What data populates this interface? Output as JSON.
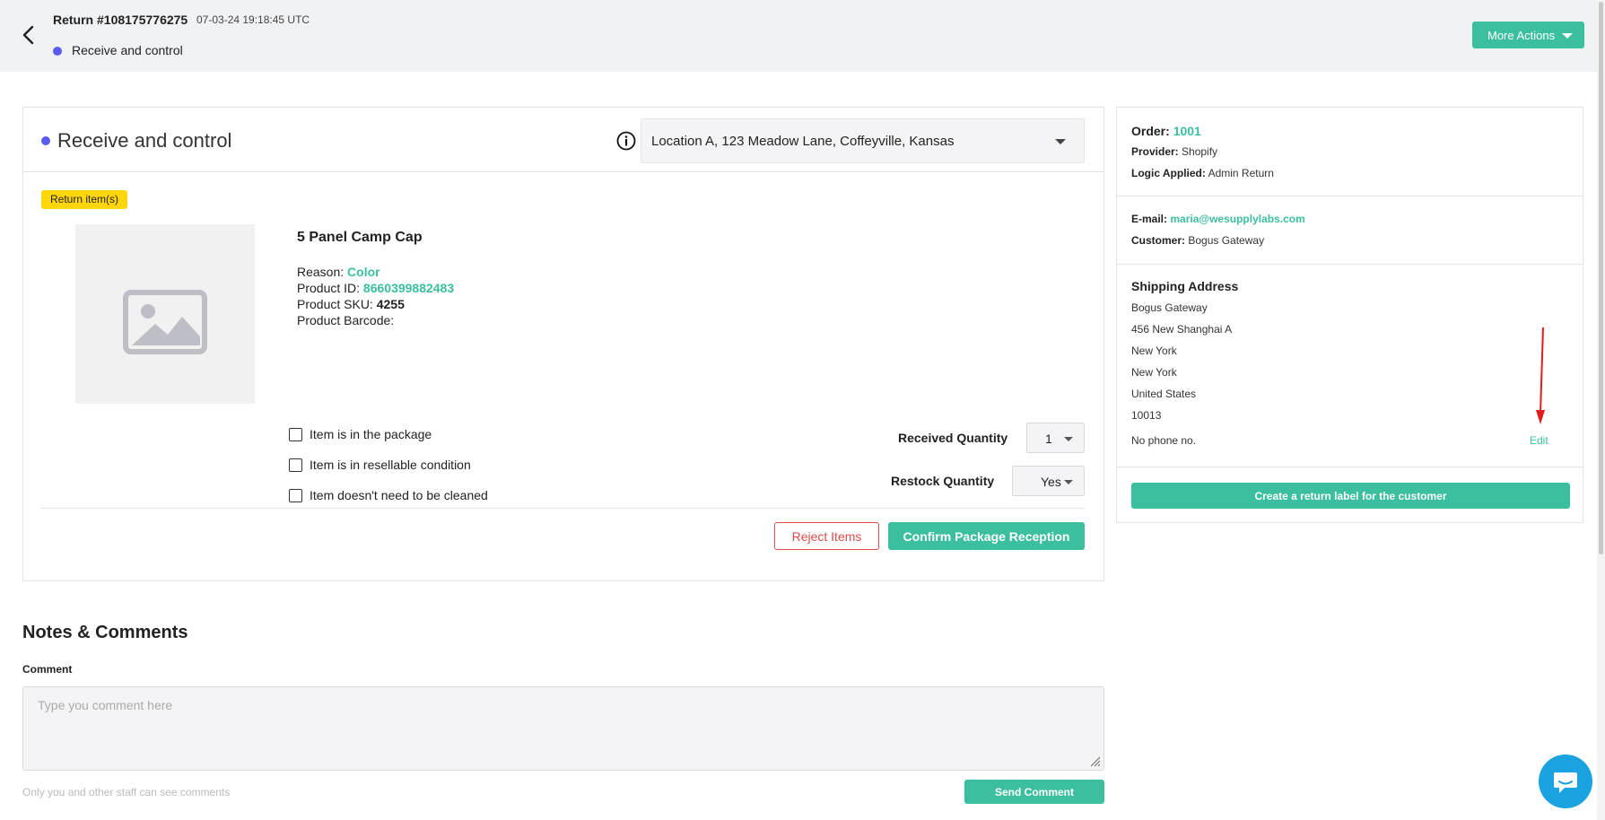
{
  "header": {
    "title": "Return #108175776275",
    "timestamp": "07-03-24 19:18:45 UTC",
    "status": "Receive and control",
    "more_actions_label": "More Actions"
  },
  "receive_card": {
    "title": "Receive and control",
    "location": "Location A, 123 Meadow Lane, Coffeyville, Kansas",
    "badge": "Return item(s)",
    "product": {
      "name": "5 Panel Camp Cap",
      "reason_label": "Reason:",
      "reason_value": "Color",
      "id_label": "Product ID:",
      "id_value": "8660399882483",
      "sku_label": "Product SKU:",
      "sku_value": "4255",
      "barcode_label": "Product Barcode:"
    },
    "checklist": [
      {
        "label": "Item is in the package",
        "checked": false
      },
      {
        "label": "Item is in resellable condition",
        "checked": false
      },
      {
        "label": "Item doesn't need to be cleaned",
        "checked": false
      }
    ],
    "received_quantity": {
      "label": "Received Quantity",
      "value": "1"
    },
    "restock_quantity": {
      "label": "Restock Quantity",
      "value": "Yes"
    },
    "reject_label": "Reject Items",
    "confirm_label": "Confirm Package Reception"
  },
  "side_card": {
    "order_label": "Order:",
    "order_value": "1001",
    "provider_label": "Provider:",
    "provider_value": "Shopify",
    "logic_label": "Logic Applied:",
    "logic_value": "Admin Return",
    "email_label": "E-mail:",
    "email_value": "maria@wesupplylabs.com",
    "customer_label": "Customer:",
    "customer_value": "Bogus Gateway",
    "shipping_title": "Shipping Address",
    "address_lines": [
      "Bogus Gateway",
      "456 New Shanghai A",
      "New York",
      "New York",
      "United States",
      "10013"
    ],
    "phone": "No phone no.",
    "edit_label": "Edit",
    "create_label_button": "Create a return label for the customer"
  },
  "notes": {
    "title": "Notes & Comments",
    "comment_label": "Comment",
    "placeholder": "Type you comment here",
    "hint": "Only you and other staff can see comments",
    "send_label": "Send Comment"
  },
  "colors": {
    "accent": "#3bbf9f",
    "status_dot": "#5a5cf0",
    "reject": "#e34b4b",
    "badge": "#ffd60a",
    "chat": "#1aa3e0"
  }
}
